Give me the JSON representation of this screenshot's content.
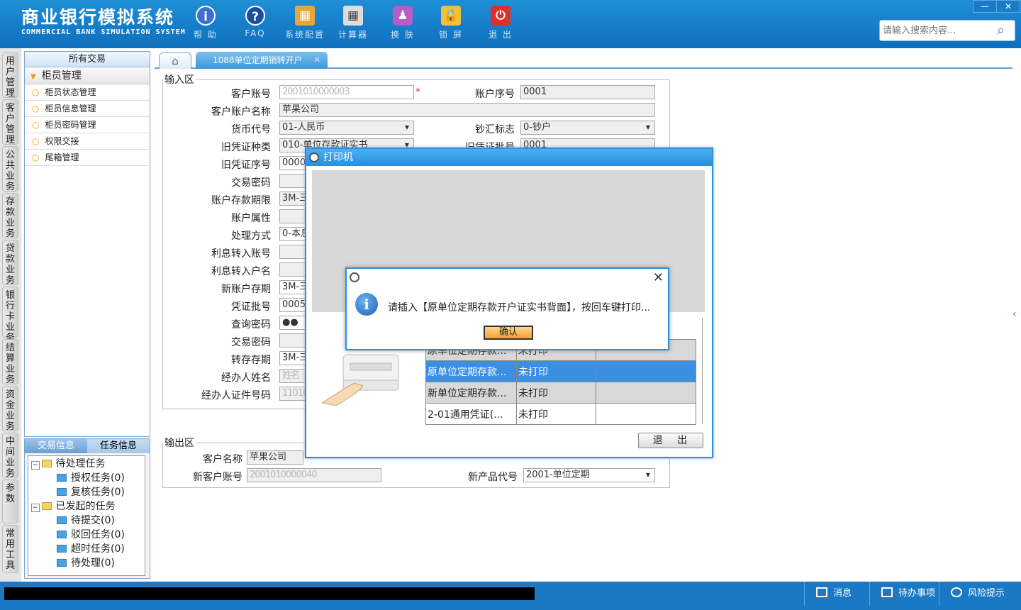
{
  "brand": {
    "cn": "商业银行模拟系统",
    "en": "COMMERCIAL BANK SIMULATION SYSTEM"
  },
  "toolbar": {
    "help": "帮 助",
    "faq": "FAQ",
    "config": "系统配置",
    "calc": "计算器",
    "skin": "换 肤",
    "lock": "锁 屏",
    "exit": "退 出"
  },
  "window": {
    "min": "—",
    "close": "✕"
  },
  "search": {
    "placeholder": "请输入搜索内容..."
  },
  "left_nav": [
    "用户管理",
    "客户管理",
    "公共业务",
    "存款业务",
    "贷款业务",
    "银行卡业务",
    "结算业务",
    "资金业务",
    "中间业务",
    "参数",
    "常用工具"
  ],
  "tree": {
    "header": "所有交易",
    "group": "柜员管理",
    "items": [
      "柜员状态管理",
      "柜员信息管理",
      "柜员密码管理",
      "权限交接",
      "尾箱管理"
    ]
  },
  "task": {
    "tabs": [
      "交易信息",
      "任务信息"
    ],
    "nodes": [
      "待处理任务",
      "授权任务(0)",
      "复核任务(0)",
      "已发起的任务",
      "待提交(0)",
      "驳回任务(0)",
      "超时任务(0)",
      "待处理(0)"
    ]
  },
  "tabs": {
    "active": "1088单位定期销转开户",
    "close": "✕"
  },
  "input_area": {
    "legend": "输入区",
    "labels": [
      "客户账号",
      "客户账户名称",
      "货币代号",
      "旧凭证种类",
      "旧凭证序号",
      "交易密码",
      "账户存款期限",
      "账户属性",
      "处理方式",
      "利息转入账号",
      "利息转入户名",
      "新账户存期",
      "凭证批号",
      "查询密码",
      "交易密码",
      "转存存期",
      "经办人姓名",
      "经办人证件号码"
    ],
    "values": {
      "acct": "2001010000003",
      "name": "苹果公司",
      "currency": "01-人民币",
      "oldtype": "010-单位存款证实书",
      "oldseq": "000000",
      "term": "3M-三",
      "handle": "0-本息",
      "newterm": "3M-三",
      "batch": "0005",
      "qpwd": "●●",
      "transterm": "3M-三",
      "agent": "姓名",
      "agentid": "110101"
    },
    "required": "*",
    "right_labels": [
      "账户序号",
      "钞汇标志",
      "旧凭证批号"
    ],
    "right_values": [
      "0001",
      "0-钞户",
      "0001"
    ]
  },
  "output_area": {
    "legend": "输出区",
    "labels": [
      "客户名称",
      "新客户账号",
      "新产品代号"
    ],
    "values": [
      "苹果公司",
      "2001010000040",
      "2001-单位定期"
    ]
  },
  "printer": {
    "title": "打印机",
    "rows": [
      [
        "原单位定期存款...",
        "未打印",
        ""
      ],
      [
        "新单位定期存款...",
        "未打印",
        ""
      ],
      [
        "2-01通用凭证(...",
        "未打印",
        ""
      ]
    ],
    "exit": "退 出"
  },
  "message": {
    "text": "请插入【原单位定期存款开户证实书背面】，按回车键打印...",
    "ok": "确认"
  },
  "status": {
    "msg": "消息",
    "todo": "待办事项",
    "risk": "风险提示"
  },
  "colors": {
    "header": "#1a78c5",
    "accent": "#2a8fdc",
    "selected": "#3b8fe3"
  }
}
